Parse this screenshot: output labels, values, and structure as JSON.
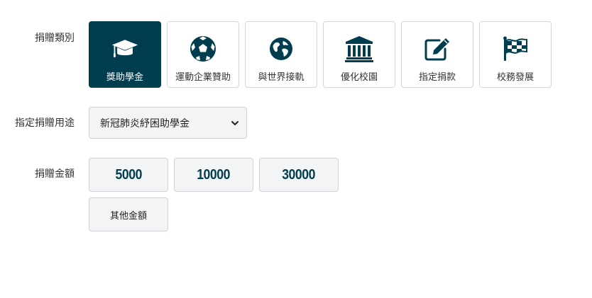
{
  "labels": {
    "category": "捐贈類別",
    "purpose": "指定捐贈用途",
    "amount": "捐贈金額"
  },
  "categories": [
    {
      "label": "獎助學金",
      "icon": "graduation-cap-icon",
      "active": true
    },
    {
      "label": "運動企業贊助",
      "icon": "soccer-ball-icon",
      "active": false
    },
    {
      "label": "與世界接軌",
      "icon": "globe-icon",
      "active": false
    },
    {
      "label": "優化校園",
      "icon": "university-building-icon",
      "active": false
    },
    {
      "label": "指定捐款",
      "icon": "edit-icon",
      "active": false
    },
    {
      "label": "校務發展",
      "icon": "checkered-flag-icon",
      "active": false
    }
  ],
  "purpose_select": {
    "selected": "新冠肺炎紓困助學金"
  },
  "amounts": [
    "5000",
    "10000",
    "30000"
  ],
  "other_amount_label": "其他金額",
  "colors": {
    "primary": "#003e4f",
    "button_bg": "#f3f4f6",
    "border": "#d6d6d6"
  }
}
